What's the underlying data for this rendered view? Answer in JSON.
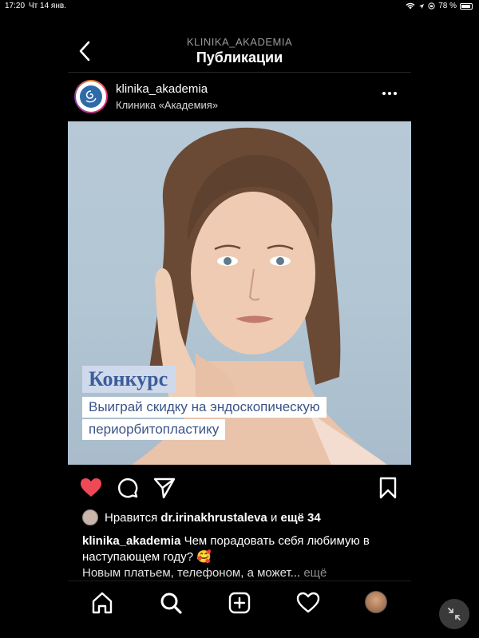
{
  "status": {
    "time": "17:20",
    "date": "Чт 14 янв.",
    "battery": "78 %"
  },
  "header": {
    "subtitle": "KLINIKA_AKADEMIA",
    "title": "Публикации"
  },
  "post": {
    "username": "klinika_akademia",
    "location": "Клиника «Академия»",
    "image": {
      "banner_title": "Конкурс",
      "banner_line1": "Выиграй скидку на эндоскопическую",
      "banner_line2": "периорбитопластику"
    },
    "liked": true,
    "likes": {
      "prefix": "Нравится",
      "user": "dr.irinakhrustaleva",
      "middle": "и",
      "others": "ещё 34"
    },
    "caption": {
      "username": "klinika_akademia",
      "text": "Чем порадовать себя любимую в наступающем году? 🥰",
      "more_text": "Новым платьем, телефоном, а может...",
      "more_link": "ещё"
    }
  },
  "icons": {
    "back": "chevron-left-icon",
    "more": "ellipsis-icon",
    "like": "heart-filled-icon",
    "comment": "comment-icon",
    "share": "send-icon",
    "save": "bookmark-icon",
    "home": "home-icon",
    "search": "search-icon",
    "add": "add-post-icon",
    "activity": "heart-icon",
    "collapse": "collapse-arrows-icon"
  },
  "colors": {
    "like": "#ed4956",
    "background": "#000000",
    "banner_title_bg": "#cfd9ec",
    "banner_text": "#3a5486"
  }
}
